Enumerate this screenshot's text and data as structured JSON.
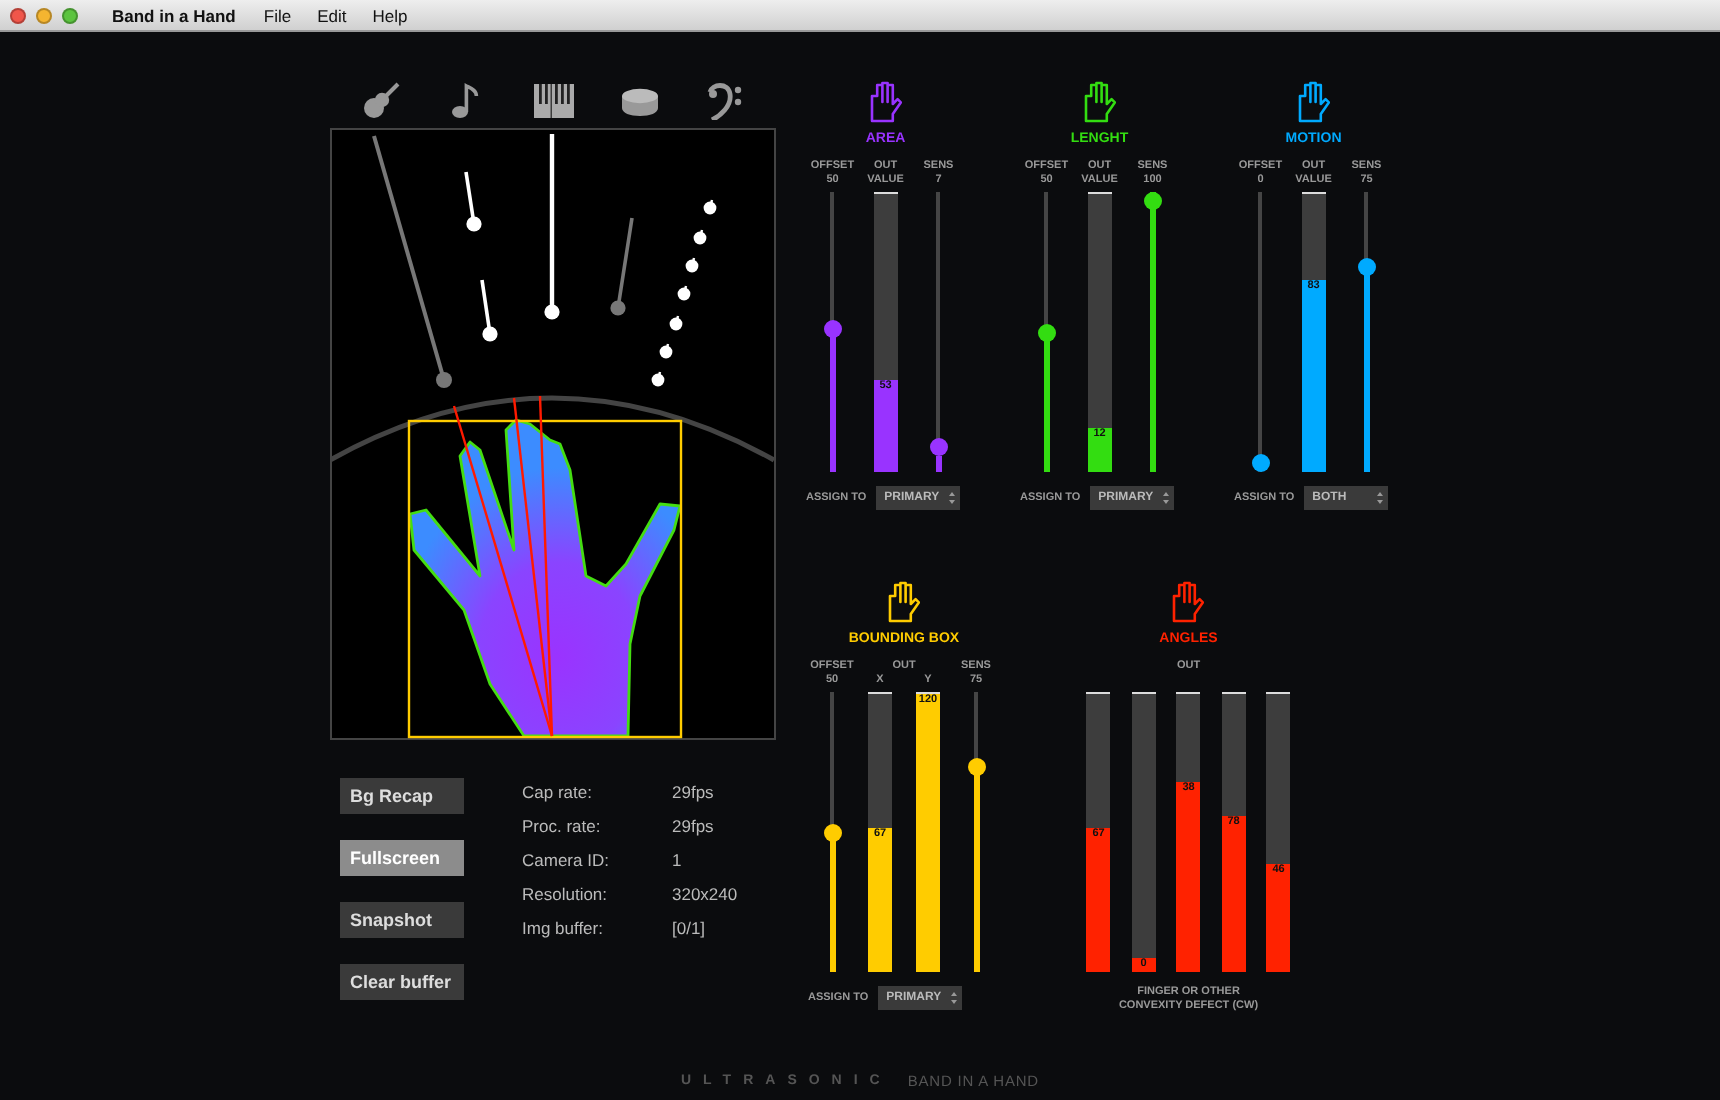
{
  "app": {
    "title": "Band in a Hand",
    "menu": [
      "File",
      "Edit",
      "Help"
    ]
  },
  "instruments": [
    {
      "kind": "guitar"
    },
    {
      "kind": "note"
    },
    {
      "kind": "piano"
    },
    {
      "kind": "drum"
    },
    {
      "kind": "bass"
    }
  ],
  "buttons": [
    {
      "label": "Bg Recap",
      "selected": false
    },
    {
      "label": "Fullscreen",
      "selected": true
    },
    {
      "label": "Snapshot",
      "selected": false
    },
    {
      "label": "Clear buffer",
      "selected": false
    }
  ],
  "stats": [
    {
      "label": "Cap rate:",
      "value": "29fps"
    },
    {
      "label": "Proc. rate:",
      "value": "29fps"
    },
    {
      "label": "Camera ID:",
      "value": "1"
    },
    {
      "label": "Resolution:",
      "value": "320x240"
    },
    {
      "label": "Img buffer:",
      "value": "[0/1]"
    }
  ],
  "sensors": [
    {
      "title": "AREA",
      "color": "#9933ff",
      "controls": [
        {
          "kind": "slider",
          "label": "OFFSET",
          "reading": "50",
          "level": 0.51
        },
        {
          "kind": "bar",
          "label": "OUT VALUE",
          "value": "53",
          "level": 0.33
        },
        {
          "kind": "slider",
          "label": "SENS",
          "reading": "7",
          "level": 0.06
        }
      ],
      "assign": {
        "label": "ASSIGN TO",
        "value": "PRIMARY"
      }
    },
    {
      "title": "LENGHT",
      "color": "#33dd11",
      "controls": [
        {
          "kind": "slider",
          "label": "OFFSET",
          "reading": "50",
          "level": 0.5
        },
        {
          "kind": "bar",
          "label": "OUT VALUE",
          "value": "12",
          "level": 0.16
        },
        {
          "kind": "slider",
          "label": "SENS",
          "reading": "100",
          "level": 1.0
        }
      ],
      "assign": {
        "label": "ASSIGN TO",
        "value": "PRIMARY"
      }
    },
    {
      "title": "MOTION",
      "color": "#00aaff",
      "controls": [
        {
          "kind": "slider",
          "label": "OFFSET",
          "reading": "0",
          "level": 0.0
        },
        {
          "kind": "bar",
          "label": "OUT VALUE",
          "value": "83",
          "level": 0.69
        },
        {
          "kind": "slider",
          "label": "SENS",
          "reading": "75",
          "level": 0.75
        }
      ],
      "assign": {
        "label": "ASSIGN TO",
        "value": "BOTH"
      }
    }
  ],
  "detectors": [
    {
      "title": "BOUNDING BOX",
      "color": "#ffcc00",
      "group_label": "OUT",
      "controls": [
        {
          "kind": "slider",
          "label": "OFFSET",
          "reading": "50",
          "level": 0.5
        },
        {
          "kind": "bar",
          "label": "X",
          "value": "67",
          "level": 0.52
        },
        {
          "kind": "bar",
          "label": "Y",
          "value": "120",
          "level": 1.0
        },
        {
          "kind": "slider",
          "label": "SENS",
          "reading": "75",
          "level": 0.75
        }
      ],
      "assign": {
        "label": "ASSIGN TO",
        "value": "PRIMARY"
      }
    },
    {
      "title": "ANGLES",
      "color": "#ff2200",
      "group_label": "OUT",
      "controls": [
        {
          "kind": "bar",
          "value": "67",
          "level": 0.52
        },
        {
          "kind": "bar",
          "value": "0",
          "level": 0.05
        },
        {
          "kind": "bar",
          "value": "38",
          "level": 0.68
        },
        {
          "kind": "bar",
          "value": "78",
          "level": 0.56
        },
        {
          "kind": "bar",
          "value": "46",
          "level": 0.39
        }
      ],
      "caption": "FINGER OR OTHER CONVEXITY DEFECT (CW)"
    }
  ],
  "footer": {
    "brand": "ULTRASONIC",
    "product": "BAND IN A HAND"
  }
}
